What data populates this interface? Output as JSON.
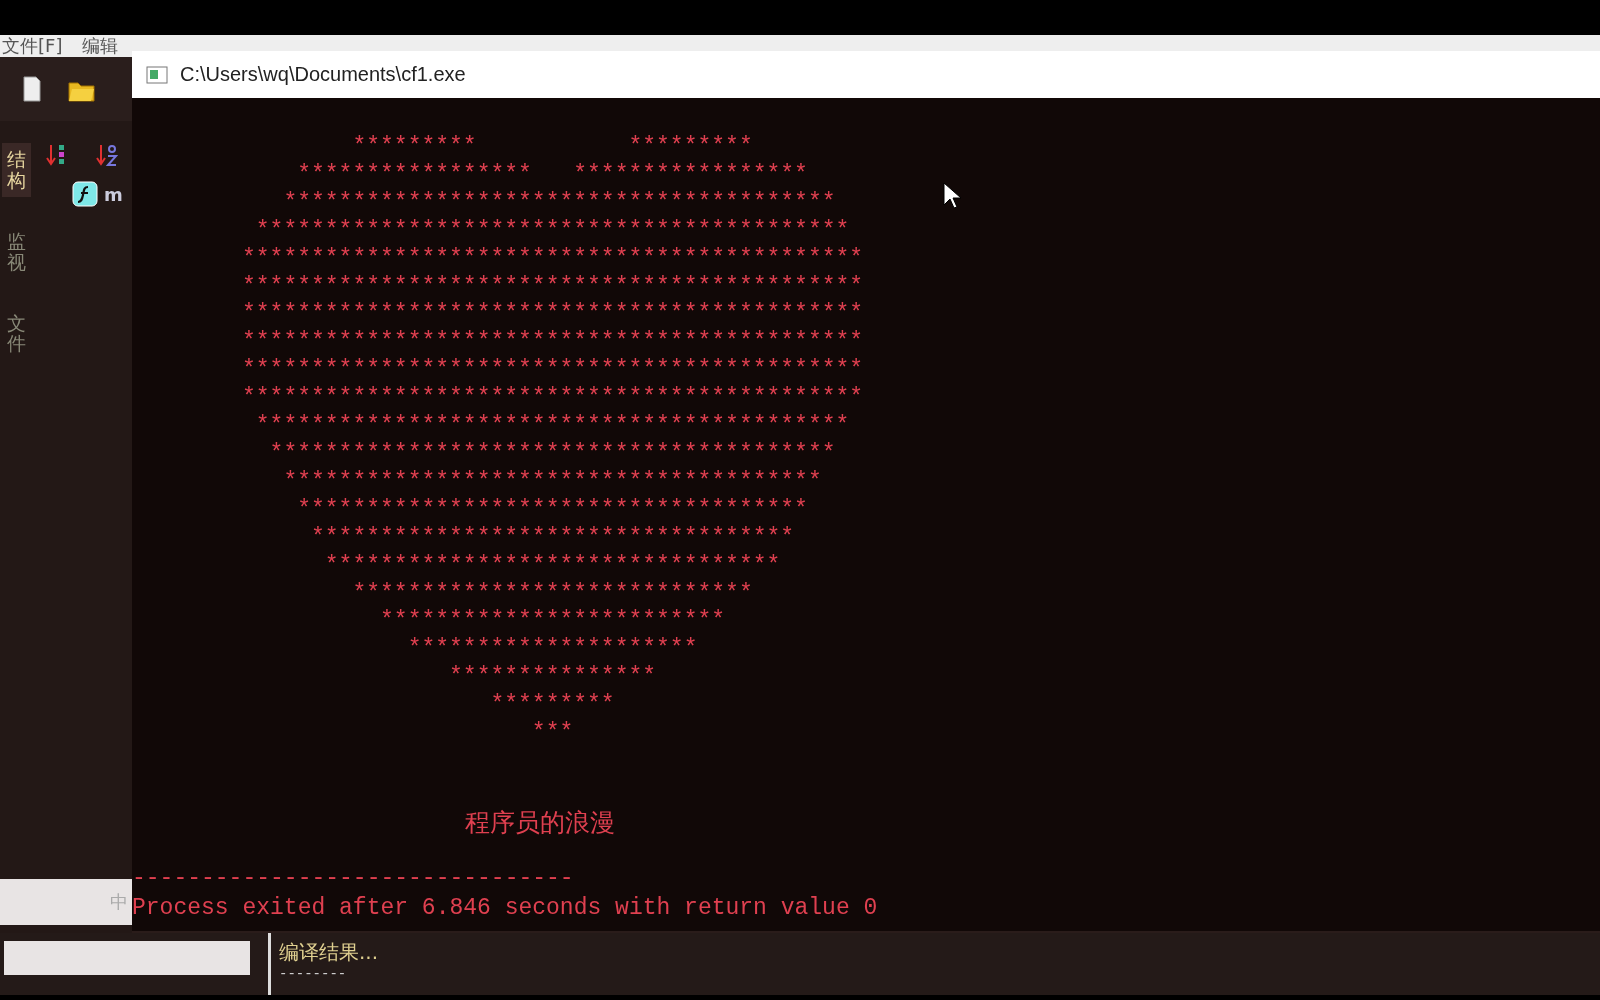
{
  "ide": {
    "menu": [
      {
        "label": "文件[F]"
      },
      {
        "label": "编辑"
      }
    ],
    "side_tabs": [
      {
        "label": "结构",
        "selected": true
      },
      {
        "label": "监视",
        "selected": false
      },
      {
        "label": "文件",
        "selected": false
      }
    ],
    "tree_item": {
      "label": "m"
    },
    "ime_indicator": "中",
    "bottom_panel": {
      "title": "编译结果...",
      "line": "--------"
    }
  },
  "console": {
    "title": "C:\\Users\\wq\\Documents\\cf1.exe",
    "heart_art": "        *********           *********\n    *****************   *****************\n   ****************************************\n *******************************************\n*********************************************\n*********************************************\n*********************************************\n*********************************************\n*********************************************\n*********************************************\n *******************************************\n  *****************************************\n   ***************************************\n    *************************************\n     ***********************************\n      *********************************\n        *****************************\n          *************************\n            *********************\n               ***************\n                  *********\n                     ***",
    "caption": "程序员的浪漫",
    "separator": "--------------------------------",
    "exit_message": "Process exited after 6.846 seconds with return value 0"
  }
}
